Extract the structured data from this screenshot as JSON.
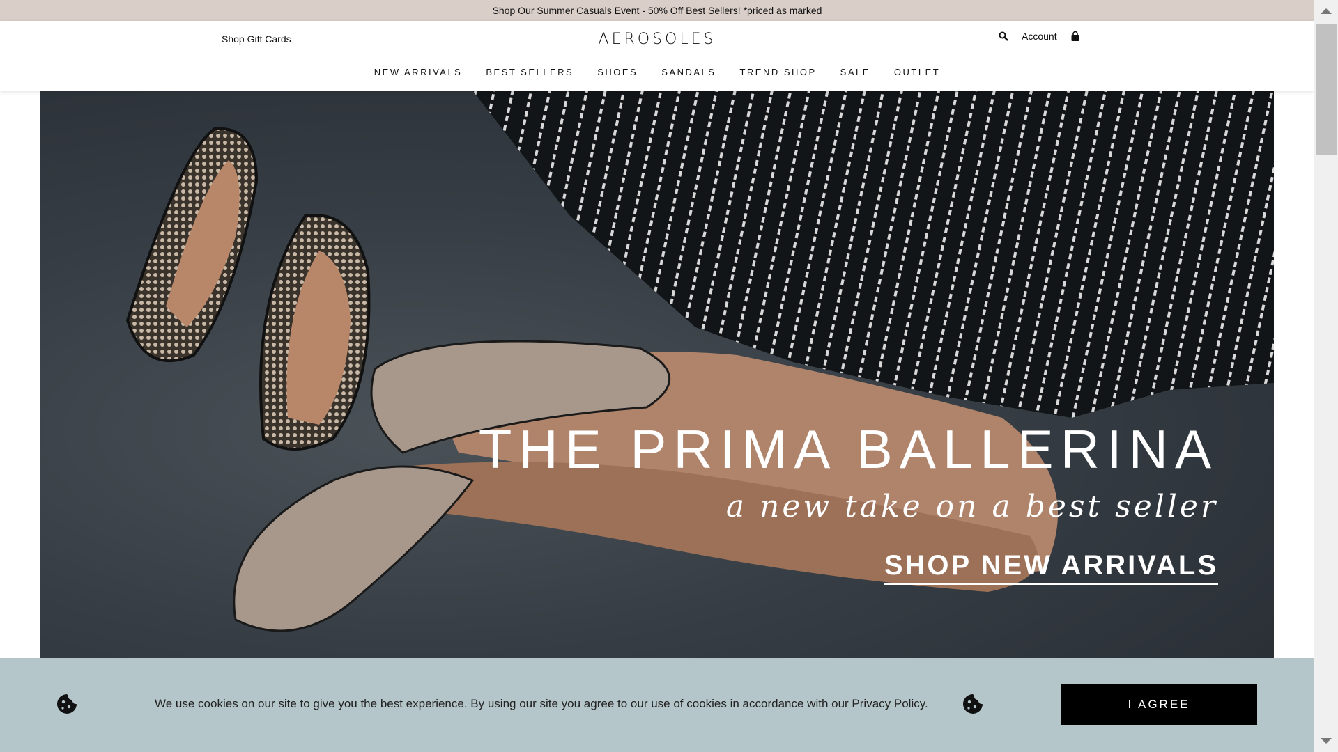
{
  "promo": {
    "text": "Shop Our Summer Casuals Event - 50% Off Best Sellers! *priced as marked"
  },
  "header": {
    "gift_cards": "Shop Gift Cards",
    "logo": "AEROSOLES",
    "account": "Account",
    "search_icon": "search-icon",
    "bag_icon": "shopping-bag-icon"
  },
  "nav": {
    "items": [
      {
        "label": "NEW ARRIVALS"
      },
      {
        "label": "BEST SELLERS"
      },
      {
        "label": "SHOES"
      },
      {
        "label": "SANDALS"
      },
      {
        "label": "TREND SHOP"
      },
      {
        "label": "SALE"
      },
      {
        "label": "OUTLET"
      }
    ]
  },
  "hero": {
    "title": "THE PRIMA BALLERINA",
    "subtitle": "a new take on a best seller",
    "cta": "SHOP NEW ARRIVALS"
  },
  "cookie": {
    "message": "We use cookies on our site to give you the best experience. By using our site you agree to our use of cookies in accordance with our Privacy Policy.",
    "agree_label": "I AGREE",
    "icon": "cookie-icon"
  },
  "colors": {
    "promo_bg": "#d9cec8",
    "cookie_bg": "#b5c6ca",
    "button_bg": "#000000"
  }
}
